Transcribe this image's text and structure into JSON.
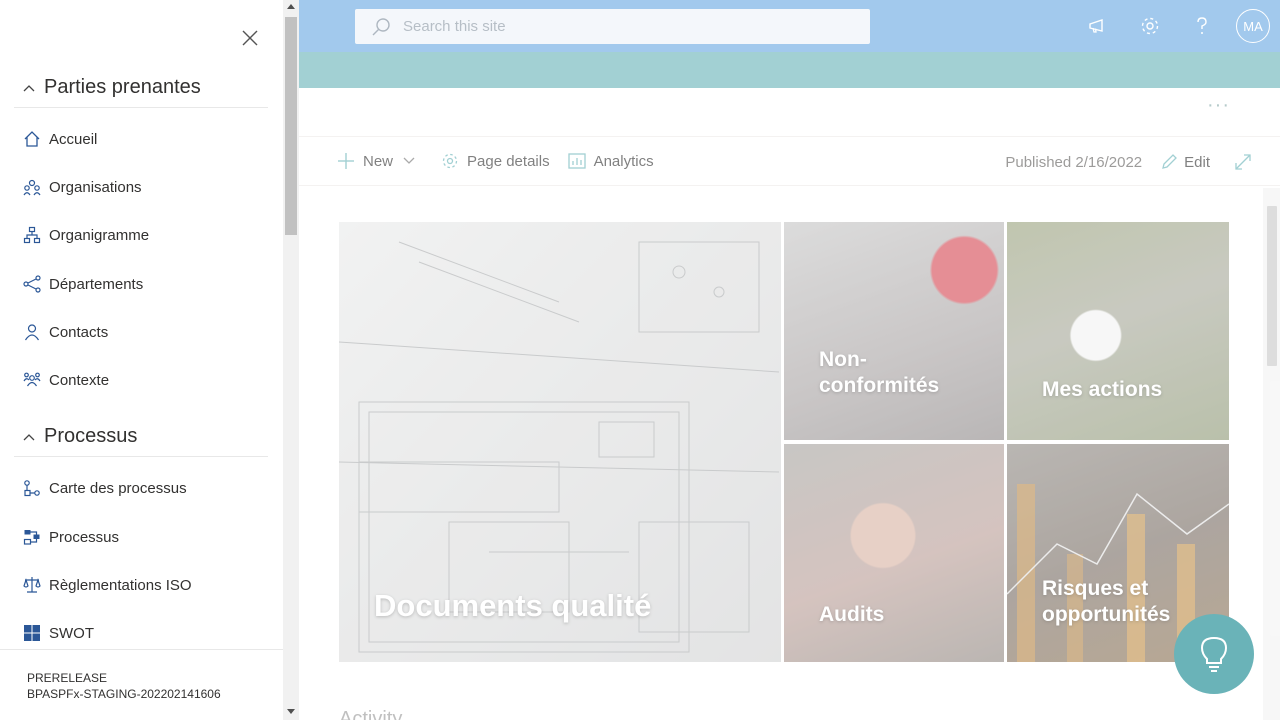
{
  "search": {
    "placeholder": "Search this site"
  },
  "suite": {
    "avatar_initials": "MA"
  },
  "commandbar": {
    "new_label": "New",
    "page_details_label": "Page details",
    "analytics_label": "Analytics",
    "published": "Published 2/16/2022",
    "edit_label": "Edit"
  },
  "hero": {
    "tiles": [
      {
        "title": "Documents qualité"
      },
      {
        "title": "Non-conformités"
      },
      {
        "title": "Mes actions"
      },
      {
        "title": "Audits"
      },
      {
        "title": "Risques et opportunités"
      }
    ]
  },
  "activity_label": "Activity",
  "nav": {
    "sections": [
      {
        "label": "Parties prenantes",
        "items": [
          {
            "label": "Accueil",
            "icon": "home-icon"
          },
          {
            "label": "Organisations",
            "icon": "people-group-icon"
          },
          {
            "label": "Organigramme",
            "icon": "org-chart-icon"
          },
          {
            "label": "Départements",
            "icon": "share-nodes-icon"
          },
          {
            "label": "Contacts",
            "icon": "person-icon"
          },
          {
            "label": "Contexte",
            "icon": "team-icon"
          }
        ]
      },
      {
        "label": "Processus",
        "items": [
          {
            "label": "Carte des processus",
            "icon": "process-map-icon"
          },
          {
            "label": "Processus",
            "icon": "process-icon"
          },
          {
            "label": "Règlementations ISO",
            "icon": "scales-icon"
          },
          {
            "label": "SWOT",
            "icon": "windows-grid-icon"
          }
        ]
      }
    ],
    "footer": {
      "line1": "PRERELEASE",
      "line2": "BPASPFx-STAGING-202202141606"
    }
  },
  "colors": {
    "suitebar": "#6aa9e2",
    "teal": "#6ab3b8",
    "nav_icon": "#2b5797"
  }
}
